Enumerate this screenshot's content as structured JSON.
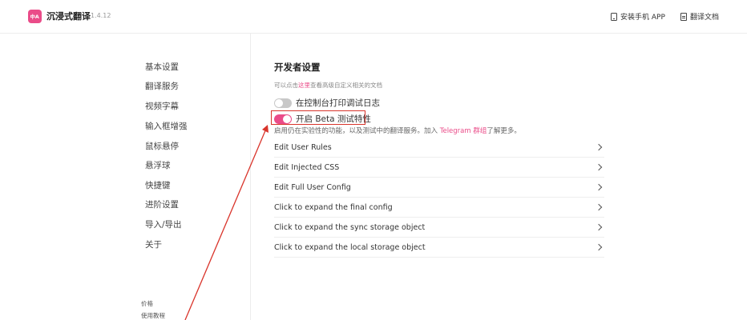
{
  "header": {
    "logo_text": "中A",
    "app_name": "沉浸式翻译",
    "version": "1.4.12",
    "install_app_label": "安装手机 APP",
    "docs_label": "翻译文档"
  },
  "sidebar": {
    "items": [
      {
        "label": "基本设置"
      },
      {
        "label": "翻译服务"
      },
      {
        "label": "视频字幕"
      },
      {
        "label": "输入框增强"
      },
      {
        "label": "鼠标悬停"
      },
      {
        "label": "悬浮球"
      },
      {
        "label": "快捷键"
      },
      {
        "label": "进阶设置"
      },
      {
        "label": "导入/导出"
      },
      {
        "label": "关于"
      }
    ],
    "footer": {
      "pricing": "价格",
      "tutorial": "使用教程"
    }
  },
  "main": {
    "title": "开发者设置",
    "desc_prefix": "可以点击",
    "desc_link": "这里",
    "desc_suffix": "查看高级自定义相关的文档",
    "debug_toggle": {
      "label": "在控制台打印调试日志",
      "on": false
    },
    "beta_toggle": {
      "label": "开启 Beta 测试特性",
      "on": true
    },
    "beta_desc_prefix": "启用仍在实验性的功能，以及测试中的翻译服务。加入 ",
    "beta_desc_link": "Telegram 群组",
    "beta_desc_suffix": "了解更多。",
    "rows": [
      {
        "label": "Edit User Rules"
      },
      {
        "label": "Edit Injected CSS"
      },
      {
        "label": "Edit Full User Config"
      },
      {
        "label": "Click to expand the final config"
      },
      {
        "label": "Click to expand the sync storage object"
      },
      {
        "label": "Click to expand the local storage object"
      }
    ]
  },
  "colors": {
    "accent": "#ea4c89",
    "annotation": "#d9342b"
  }
}
